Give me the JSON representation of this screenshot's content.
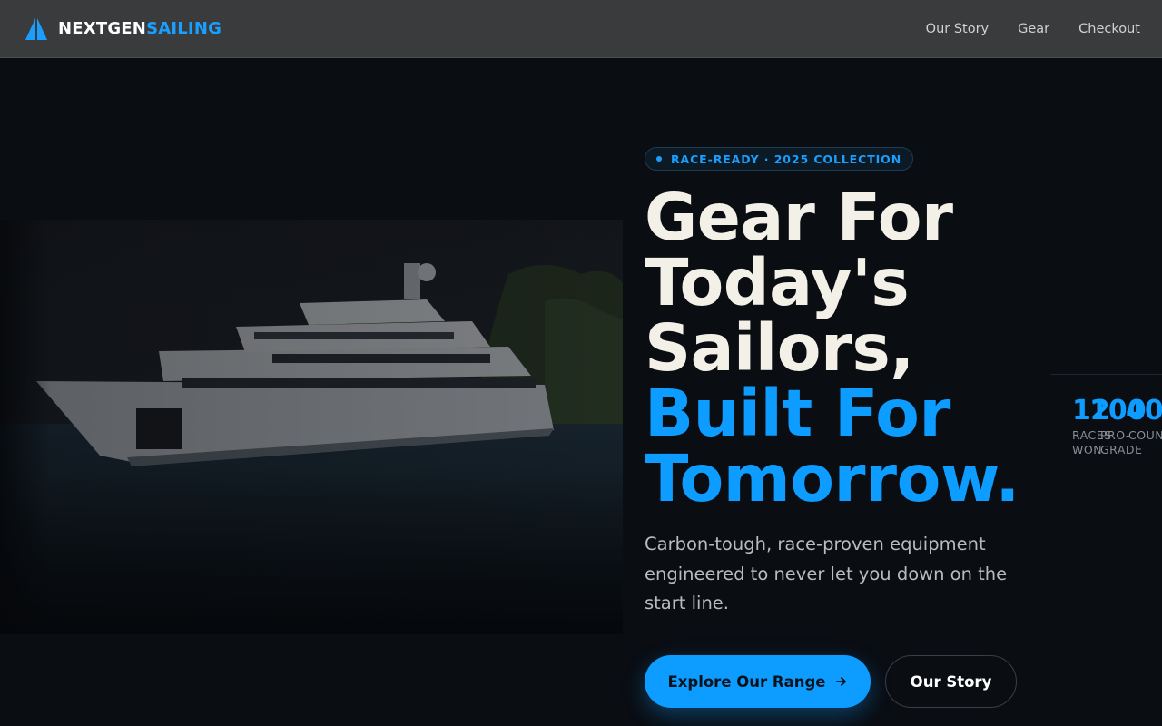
{
  "brand": {
    "name_part1": "NEXTGEN",
    "name_part2": "SAILING"
  },
  "nav": {
    "links": [
      "Our Story",
      "Gear",
      "Checkout"
    ]
  },
  "hero": {
    "badge": "RACE-READY · 2025 COLLECTION",
    "headline_white": [
      "Gear For",
      "Today's",
      "Sailors,"
    ],
    "headline_blue": [
      "Built For",
      "Tomorrow."
    ],
    "subtext": "Carbon-tough, race-proven equipment engineered to never let you down on the start line.",
    "cta_primary": "Explore Our Range",
    "cta_primary_icon": "arrow-right-icon",
    "cta_secondary": "Our Story",
    "image_description_icon": "yacht-photo"
  },
  "stats": [
    {
      "number": "12",
      "label": "RACES WON"
    },
    {
      "number": "100",
      "label": "PRO-GRADE"
    },
    {
      "number": "40",
      "label": "COUN"
    }
  ],
  "colors": {
    "accent": "#0d9cff",
    "background": "#0a0d12",
    "navbar": "#3a3b3d"
  }
}
